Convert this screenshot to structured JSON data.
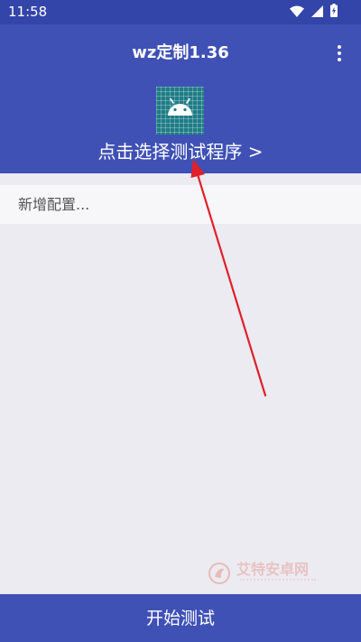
{
  "status_bar": {
    "time": "11:58",
    "icons": [
      "wifi-icon",
      "cellular-signal-icon",
      "battery-charging-icon"
    ]
  },
  "header": {
    "title": "wz定制1.36",
    "menu_icon": "more-vert-icon",
    "app_icon": "android-icon",
    "select_program_label": "点击选择测试程序 >"
  },
  "config": {
    "add_config_label": "新增配置..."
  },
  "watermark": {
    "text": "艾特安卓网"
  },
  "bottom_bar": {
    "start_label": "开始测试"
  },
  "colors": {
    "primary": "#3f51b5",
    "status_bar": "#3345a8",
    "background": "#ebebf1",
    "annotation_arrow": "#e0202a",
    "icon_teal": "#1e7c86"
  }
}
